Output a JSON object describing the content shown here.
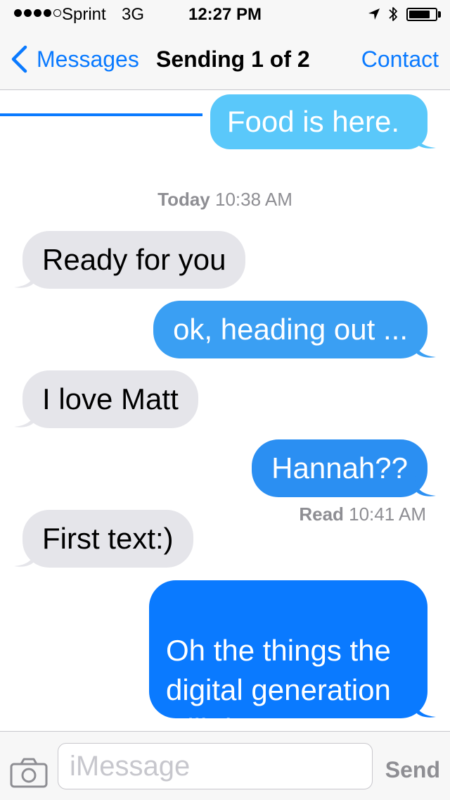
{
  "status_bar": {
    "carrier": "Sprint",
    "network": "3G",
    "time": "12:27 PM",
    "signal_bars": 4,
    "signal_max": 5,
    "battery_level": 0.8,
    "icons": [
      "location-arrow-icon",
      "bluetooth-icon",
      "battery-icon"
    ]
  },
  "nav": {
    "back_label": "Messages",
    "title": "Sending 1 of 2",
    "contact_label": "Contact",
    "send_progress": 0.45
  },
  "conversation": {
    "messages": [
      {
        "from": "me",
        "text": "Food is here."
      },
      {
        "from": "them",
        "text": "Ready for you"
      },
      {
        "from": "me",
        "text": "ok, heading out ..."
      },
      {
        "from": "them",
        "text": "I love Matt"
      },
      {
        "from": "me",
        "text": "Hannah??"
      },
      {
        "from": "them",
        "text": "First text:)"
      },
      {
        "from": "me",
        "text": "Oh the things the\ndigital generation\nwill do ..."
      }
    ],
    "timestamp_day": "Today",
    "timestamp_time": "10:38 AM",
    "read_label": "Read",
    "read_time": "10:41 AM"
  },
  "input": {
    "placeholder": "iMessage",
    "value": "",
    "send_label": "Send"
  },
  "colors": {
    "ios_blue": "#0a7aff",
    "bubble_light_blue": "#5ac8fa",
    "bubble_grey": "#e5e5ea",
    "text_secondary": "#8e8e93"
  }
}
